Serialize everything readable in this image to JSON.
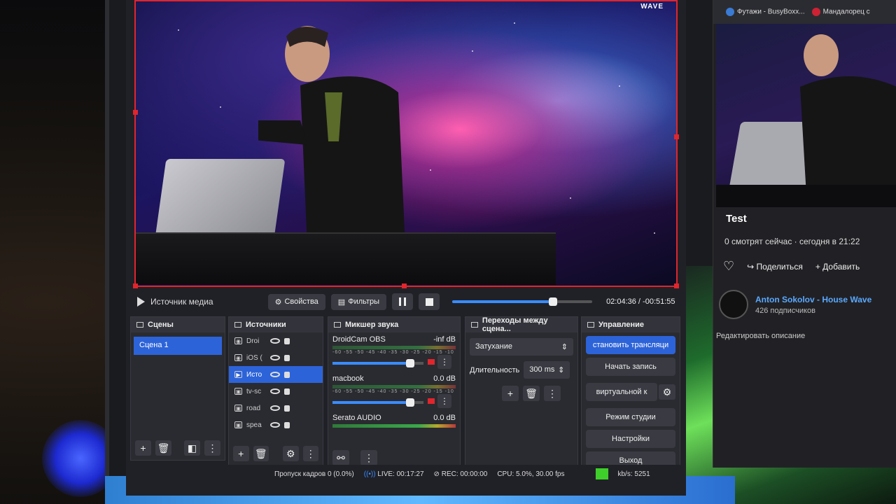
{
  "preview": {
    "brand": "WAVE"
  },
  "media_bar": {
    "source_name": "Источник медиа",
    "properties": "Свойства",
    "filters": "Фильтры",
    "progress": 0.72,
    "time": "02:04:36  /  -00:51:55"
  },
  "scenes": {
    "title": "Сцены",
    "items": [
      "Сцена 1"
    ]
  },
  "sources": {
    "title": "Источники",
    "items": [
      {
        "label": "Droi",
        "icon": "camera-icon"
      },
      {
        "label": "iOS (",
        "icon": "camera-icon"
      },
      {
        "label": "Исто",
        "icon": "play-icon"
      },
      {
        "label": "tv-sc",
        "icon": "image-icon"
      },
      {
        "label": "road",
        "icon": "image-icon"
      },
      {
        "label": "spea",
        "icon": "image-icon"
      }
    ]
  },
  "mixer": {
    "title": "Микшер звука",
    "scale": "-60 -55 -50 -45 -40 -35 -30 -25 -20 -15 -10 -5 0",
    "tracks": [
      {
        "name": "DroidCam OBS",
        "level": "-inf dB",
        "volume": 0.85
      },
      {
        "name": "macbook",
        "level": "0.0 dB",
        "volume": 0.85
      },
      {
        "name": "Serato AUDIO",
        "level": "0.0 dB",
        "volume": 1.0
      }
    ]
  },
  "transitions": {
    "title": "Переходы между сцена...",
    "selected": "Затухание",
    "duration_label": "Длительность",
    "duration_value": "300 ms"
  },
  "controls": {
    "title": "Управление",
    "buttons": [
      "становить трансляци",
      "Начать запись",
      "виртуальной к",
      "Режим студии",
      "Настройки",
      "Выход"
    ]
  },
  "status": {
    "dropped": "Пропуск кадров 0 (0.0%)",
    "live": "LIVE: 00:17:27",
    "rec": "REC: 00:00:00",
    "cpu": "CPU: 5.0%, 30.00 fps",
    "kbs": "kb/s: 5251"
  },
  "browser": {
    "tabs": [
      "Футажи - BusyBoxx...",
      "Мандалорец с"
    ],
    "title": "Test",
    "meta": "0 смотрят сейчас  ·  сегодня в 21:22",
    "share": "Поделиться",
    "add": "Добавить",
    "channel": "Anton Sokolov - House Wave",
    "subs": "426 подписчиков",
    "edit": "Редактировать описание"
  },
  "colors": {
    "accent": "#2d63d8",
    "rec_border": "#e0252d",
    "status_ok": "#3fcf2a"
  }
}
